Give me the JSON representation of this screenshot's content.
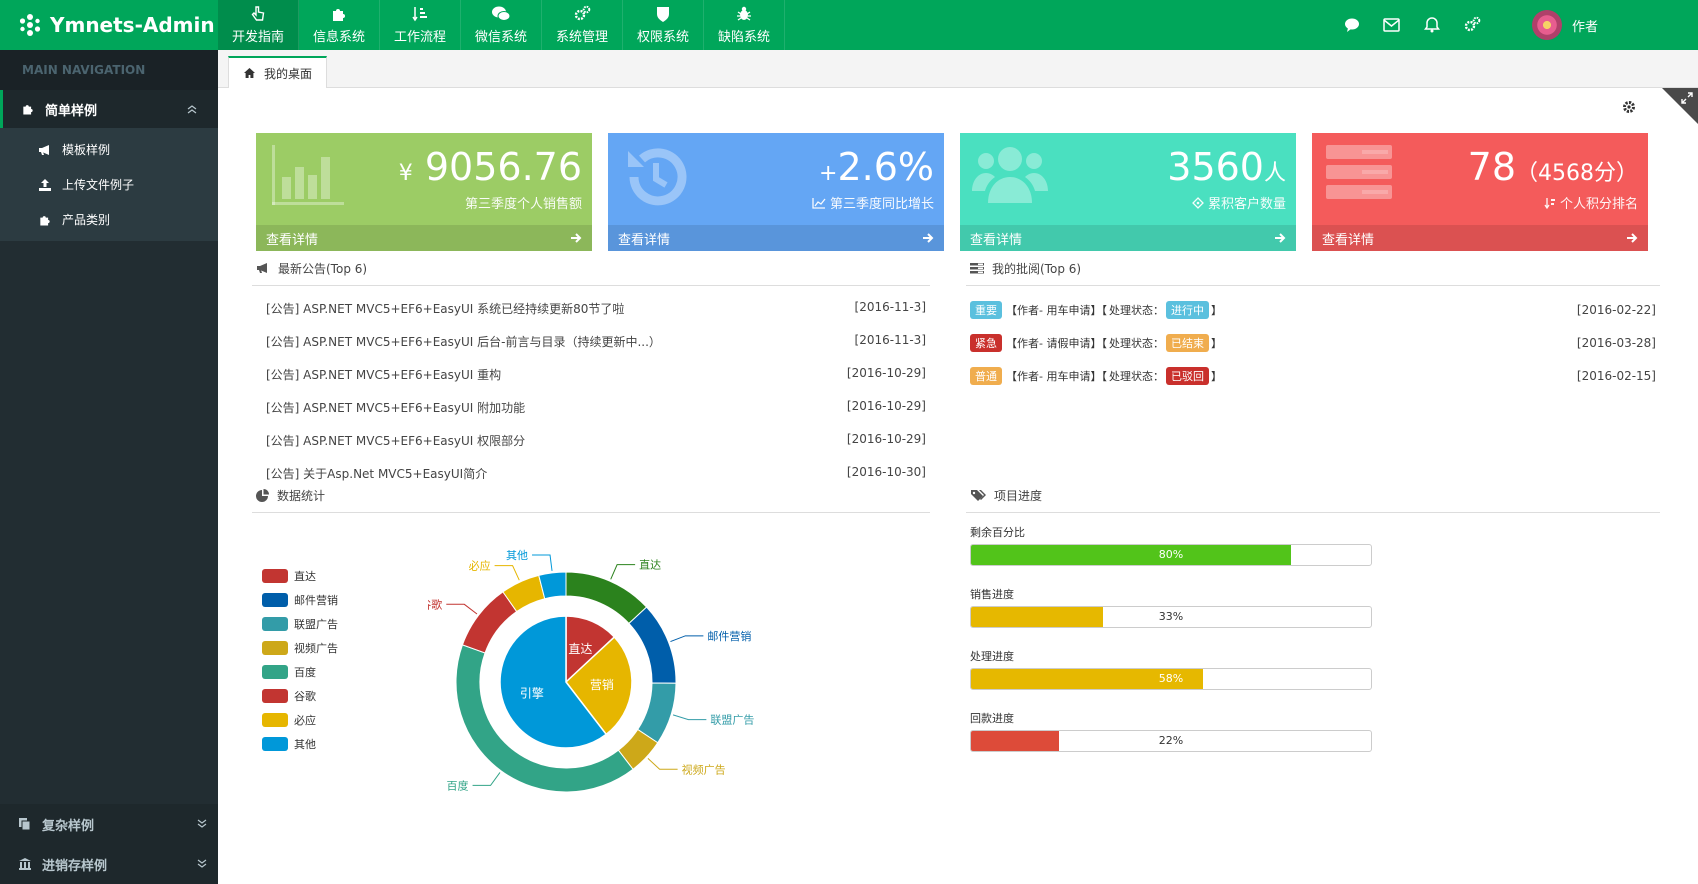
{
  "app": {
    "brand": "Ymnets-Admin"
  },
  "topnav": [
    {
      "label": "开发指南",
      "icon": "hand-pointer-icon"
    },
    {
      "label": "信息系统",
      "icon": "puzzle-icon"
    },
    {
      "label": "工作流程",
      "icon": "sort-icon"
    },
    {
      "label": "微信系统",
      "icon": "wechat-icon"
    },
    {
      "label": "系统管理",
      "icon": "gears-icon"
    },
    {
      "label": "权限系统",
      "icon": "shield-icon"
    },
    {
      "label": "缺陷系统",
      "icon": "bug-icon"
    }
  ],
  "user": {
    "name": "作者"
  },
  "sidebar": {
    "header": "MAIN NAVIGATION",
    "group": "简单样例",
    "items": [
      {
        "label": "模板样例"
      },
      {
        "label": "上传文件例子"
      },
      {
        "label": "产品类别"
      }
    ],
    "bottom": [
      {
        "label": "复杂样例"
      },
      {
        "label": "进销存样例"
      }
    ]
  },
  "tab": {
    "label": "我的桌面"
  },
  "cards": [
    {
      "prefix": "¥",
      "value": "9056.76",
      "suffix": "",
      "desc": "第三季度个人销售额",
      "foot": "查看详情",
      "color": "#9ccc65"
    },
    {
      "prefix": "+",
      "value": "2.6%",
      "suffix": "",
      "desc": "第三季度同比增长",
      "foot": "查看详情",
      "color": "#64a6f4"
    },
    {
      "prefix": "",
      "value": "3560",
      "suffix": "人",
      "desc": "累积客户数量",
      "foot": "查看详情",
      "color": "#4ae0c0"
    },
    {
      "prefix": "",
      "value": "78",
      "suffix": "（4568分）",
      "desc": "个人积分排名",
      "foot": "查看详情",
      "color": "#f45b5b"
    }
  ],
  "notices": {
    "title": "最新公告(Top 6)",
    "items": [
      {
        "text": "[公告] ASP.NET MVC5+EF6+EasyUI 系统已经持续更新80节了啦",
        "date": "[2016-11-3]"
      },
      {
        "text": "[公告] ASP.NET MVC5+EF6+EasyUI 后台-前言与目录（持续更新中...）",
        "date": "[2016-11-3]"
      },
      {
        "text": "[公告] ASP.NET MVC5+EF6+EasyUI 重构",
        "date": "[2016-10-29]"
      },
      {
        "text": "[公告] ASP.NET MVC5+EF6+EasyUI 附加功能",
        "date": "[2016-10-29]"
      },
      {
        "text": "[公告] ASP.NET MVC5+EF6+EasyUI 权限部分",
        "date": "[2016-10-29]"
      },
      {
        "text": "[公告] 关于Asp.Net MVC5+EasyUI简介",
        "date": "[2016-10-30]"
      }
    ]
  },
  "approvals": {
    "title": "我的批阅(Top 6)",
    "status_label": "处理状态：",
    "items": [
      {
        "level": "重要",
        "level_color": "#5bc0de",
        "text": "【作者- 用车申请】【",
        "status": "进行中",
        "status_color": "#5bc0de",
        "close": "】",
        "date": "[2016-02-22]"
      },
      {
        "level": "紧急",
        "level_color": "#c9302c",
        "text": "【作者- 请假申请】【",
        "status": "已结束",
        "status_color": "#f0ad4e",
        "close": "】",
        "date": "[2016-03-28]"
      },
      {
        "level": "普通",
        "level_color": "#f0ad4e",
        "text": "【作者- 用车申请】【",
        "status": "已驳回",
        "status_color": "#c9302c",
        "close": "】",
        "date": "[2016-02-15]"
      }
    ]
  },
  "stats": {
    "title": "数据统计"
  },
  "progress": {
    "title": "项目进度",
    "items": [
      {
        "label": "剩余百分比",
        "percent": 80,
        "text": "80%",
        "color": "#52c41a"
      },
      {
        "label": "销售进度",
        "percent": 33,
        "text": "33%",
        "color": "#e6b800"
      },
      {
        "label": "处理进度",
        "percent": 58,
        "text": "58%",
        "color": "#e6b800"
      },
      {
        "label": "回款进度",
        "percent": 22,
        "text": "22%",
        "color": "#dd4b39"
      }
    ]
  },
  "chart_data": {
    "type": "pie",
    "legend": [
      "直达",
      "邮件营销",
      "联盟广告",
      "视频广告",
      "百度",
      "谷歌",
      "必应",
      "其他"
    ],
    "legend_colors": [
      "#c23531",
      "#005eaa",
      "#339ca8",
      "#cda819",
      "#32a487",
      "#c23531",
      "#e6b600",
      "#0098d9"
    ],
    "inner": {
      "labels": [
        "直达",
        "营销",
        "引擎"
      ],
      "values": [
        335,
        679,
        1548
      ],
      "colors": [
        "#c23531",
        "#e6b600",
        "#0098d9"
      ]
    },
    "outer": {
      "labels": [
        "直达",
        "邮件营销",
        "联盟广告",
        "视频广告",
        "百度",
        "谷歌",
        "必应",
        "其他"
      ],
      "values": [
        335,
        310,
        234,
        135,
        1048,
        251,
        147,
        102
      ],
      "colors": [
        "#2b821d",
        "#005eaa",
        "#339ca8",
        "#cda819",
        "#32a487",
        "#c23531",
        "#e6b600",
        "#0098d9"
      ]
    }
  }
}
